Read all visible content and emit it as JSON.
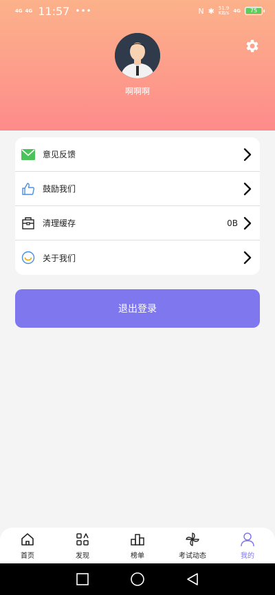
{
  "status_bar": {
    "signal1": "4G",
    "signal2": "4G",
    "time": "11:57",
    "dots": "•••",
    "net_speed_top": "51.9",
    "net_speed_bottom": "KB/s",
    "network": "4G",
    "battery": "75"
  },
  "profile": {
    "username": "啊啊啊"
  },
  "menu": {
    "items": [
      {
        "label": "意见反馈",
        "value": ""
      },
      {
        "label": "鼓励我们",
        "value": ""
      },
      {
        "label": "清理缓存",
        "value": "0B"
      },
      {
        "label": "关于我们",
        "value": ""
      }
    ]
  },
  "logout_label": "退出登录",
  "tabs": [
    {
      "label": "首页"
    },
    {
      "label": "发现"
    },
    {
      "label": "榜单"
    },
    {
      "label": "考试动态"
    },
    {
      "label": "我的"
    }
  ],
  "colors": {
    "accent": "#7f77ee",
    "header_top": "#fcb28a",
    "header_bottom": "#fd8b8b"
  }
}
